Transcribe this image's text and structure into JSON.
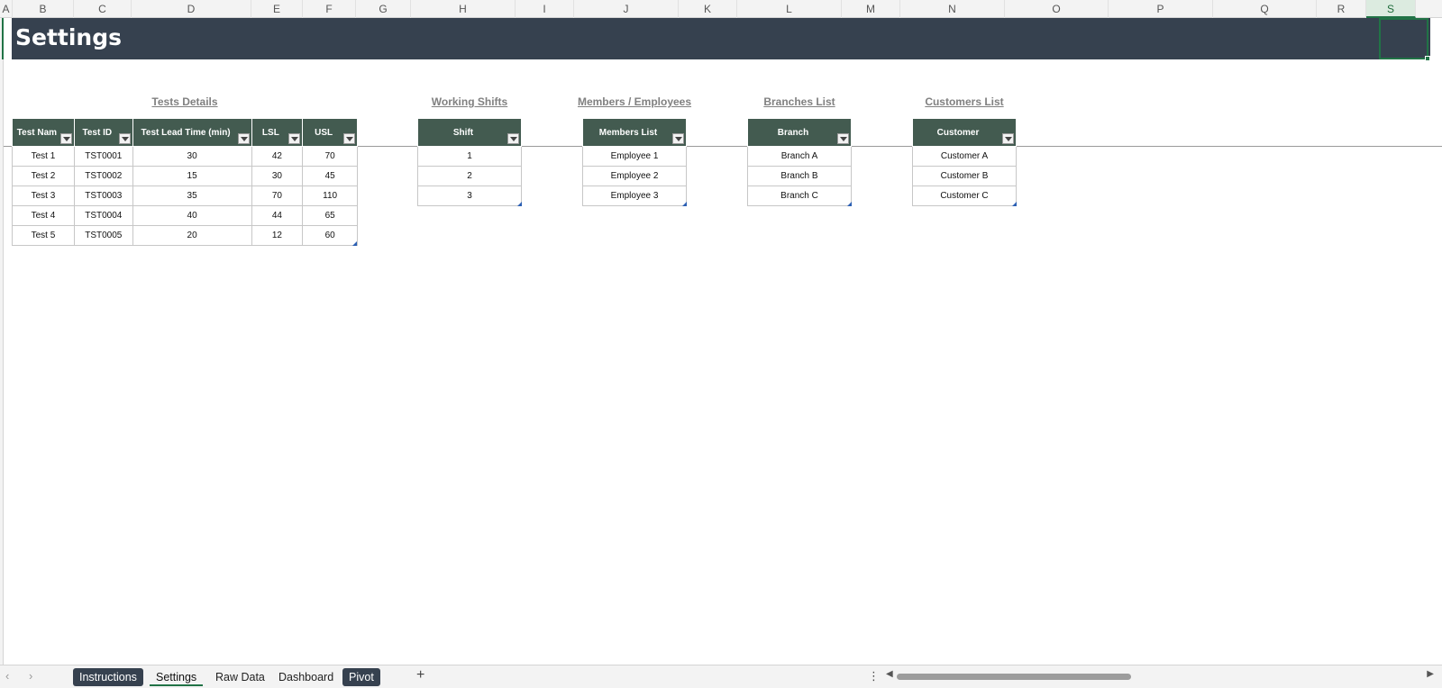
{
  "columns": [
    "A",
    "B",
    "C",
    "D",
    "E",
    "F",
    "G",
    "H",
    "I",
    "J",
    "K",
    "L",
    "M",
    "N",
    "O",
    "P",
    "Q",
    "R",
    "S"
  ],
  "selected_column": "S",
  "banner": {
    "title": "Settings"
  },
  "sections": {
    "tests": {
      "title": "Tests Details",
      "headers": [
        "Test Nam",
        "Test ID",
        "Test Lead Time (min)",
        "LSL",
        "USL"
      ],
      "rows": [
        [
          "Test 1",
          "TST0001",
          "30",
          "42",
          "70"
        ],
        [
          "Test 2",
          "TST0002",
          "15",
          "30",
          "45"
        ],
        [
          "Test 3",
          "TST0003",
          "35",
          "70",
          "110"
        ],
        [
          "Test 4",
          "TST0004",
          "40",
          "44",
          "65"
        ],
        [
          "Test 5",
          "TST0005",
          "20",
          "12",
          "60"
        ]
      ]
    },
    "shifts": {
      "title": "Working Shifts",
      "header": "Shift",
      "rows": [
        "1",
        "2",
        "3"
      ]
    },
    "members": {
      "title": "Members / Employees",
      "header": "Members List",
      "rows": [
        "Employee 1",
        "Employee 2",
        "Employee 3"
      ]
    },
    "branches": {
      "title": "Branches List",
      "header": "Branch",
      "rows": [
        "Branch A",
        "Branch B",
        "Branch C"
      ]
    },
    "customers": {
      "title": "Customers List",
      "header": "Customer",
      "rows": [
        "Customer A",
        "Customer B",
        "Customer C"
      ]
    }
  },
  "sheet_tabs": [
    {
      "label": "Instructions",
      "style": "dark"
    },
    {
      "label": "Settings",
      "style": "active"
    },
    {
      "label": "Raw Data",
      "style": "plain"
    },
    {
      "label": "Dashboard",
      "style": "plain"
    },
    {
      "label": "Pivot",
      "style": "dark"
    }
  ],
  "icons": {
    "nav_prev": "chevron-left-icon",
    "nav_next": "chevron-right-icon",
    "add_sheet": "plus-icon",
    "more": "vertical-dots-icon",
    "filter": "filter-dropdown-icon"
  },
  "colors": {
    "banner": "#36414f",
    "table_header": "#435b50",
    "selection": "#217346"
  }
}
